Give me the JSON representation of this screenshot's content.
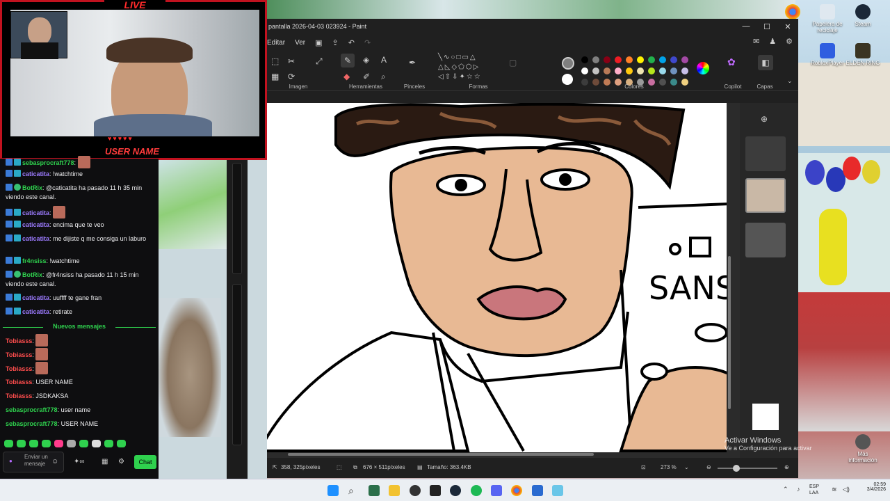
{
  "overlay": {
    "live_label": "LIVE",
    "user_tag": "USER NAME",
    "hearts": "♥♥♥♥♥"
  },
  "chat": {
    "messages": [
      {
        "user": "sebasprocraft778",
        "text": "",
        "color": "#2fd14e"
      },
      {
        "user": "caticatita",
        "text": "!watchtime",
        "color": "#9c7bff"
      },
      {
        "user": "BotRix",
        "text": "@caticatita ha pasado 11 h 35 min viendo este canal.",
        "color": "#2fd14e"
      },
      {
        "user": "caticatita",
        "text": "",
        "color": "#9c7bff"
      },
      {
        "user": "caticatita",
        "text": "encima que te veo",
        "color": "#9c7bff"
      },
      {
        "user": "caticatita",
        "text": "me dijiste q me consiga un laburo",
        "color": "#9c7bff"
      },
      {
        "user": "fr4nsiss",
        "text": "!watchtime",
        "color": "#2fd14e"
      },
      {
        "user": "BotRix",
        "text": "@fr4nsiss ha pasado 11 h 15 min viendo este canal.",
        "color": "#2fd14e"
      },
      {
        "user": "caticatita",
        "text": "uuffff te gane fran",
        "color": "#9c7bff"
      },
      {
        "user": "caticatita",
        "text": "retirate",
        "color": "#9c7bff"
      }
    ],
    "new_messages_label": "Nuevos mensajes",
    "new_messages": [
      {
        "user": "Tobiasss",
        "text": "",
        "color": "#ff4d4d"
      },
      {
        "user": "Tobiasss",
        "text": "",
        "color": "#ff4d4d"
      },
      {
        "user": "Tobiasss",
        "text": "",
        "color": "#ff4d4d"
      },
      {
        "user": "Tobiasss",
        "text": "USER NAME",
        "color": "#ff4d4d"
      },
      {
        "user": "Tobiasss",
        "text": "JSDKAKSA",
        "color": "#ff4d4d"
      },
      {
        "user": "sebasprocraft778",
        "text": "user name",
        "color": "#2fd14e"
      },
      {
        "user": "sebasprocraft778",
        "text": "USER NAME",
        "color": "#2fd14e"
      }
    ],
    "input_placeholder": "Enviar un mensaje",
    "chat_button": "Chat"
  },
  "paint": {
    "title": "pantalla 2026-04-03 023924 - Paint",
    "menu": [
      "Editar",
      "Ver"
    ],
    "groups": {
      "imagen": "Imagen",
      "herramientas": "Herramientas",
      "pinceles": "Pinceles",
      "formas": "Formas",
      "colores": "Colores",
      "copilot": "Copilot",
      "capas": "Capas"
    },
    "palette": [
      "#000000",
      "#7f7f7f",
      "#880015",
      "#ed1c24",
      "#ff7f27",
      "#fff200",
      "#22b14c",
      "#00a2e8",
      "#3f48cc",
      "#a349a4",
      "#ffffff",
      "#c3c3c3",
      "#b97a57",
      "#ffaec9",
      "#ffc90e",
      "#efe4b0",
      "#b5e61d",
      "#99d9ea",
      "#7092be",
      "#c8bfe7",
      "#3c3c3c",
      "#6e4b3a",
      "#c07b55",
      "#e0a080",
      "#d9b080",
      "#9a9a9a",
      "#c86ea0",
      "#505050",
      "#3a8a8a",
      "#f0d080"
    ],
    "status": {
      "cursor": "358, 325píxeles",
      "size": "676 × 511píxeles",
      "file_size": "Tamaño: 363.4KB",
      "zoom": "273 %"
    },
    "drawing_text": "SANS"
  },
  "desktop": {
    "icons": [
      {
        "label": "",
        "color": "#e94235"
      },
      {
        "label": "Papelera de reciclaje",
        "color": "#dfe8f0"
      },
      {
        "label": "Steam",
        "color": "#1b2838"
      },
      {
        "label": "RobloxPlayer",
        "color": "#2f5ee0"
      },
      {
        "label": "ELDEN RING",
        "color": "#3a3422"
      },
      {
        "label": "Más información",
        "color": "#555555"
      }
    ],
    "activate_title": "Activar Windows",
    "activate_sub": "Ve a Configuración para activar"
  },
  "taskbar": {
    "lang": "ESP",
    "lang_sub": "LAA",
    "time": "02:59",
    "date": "3/4/2026"
  }
}
